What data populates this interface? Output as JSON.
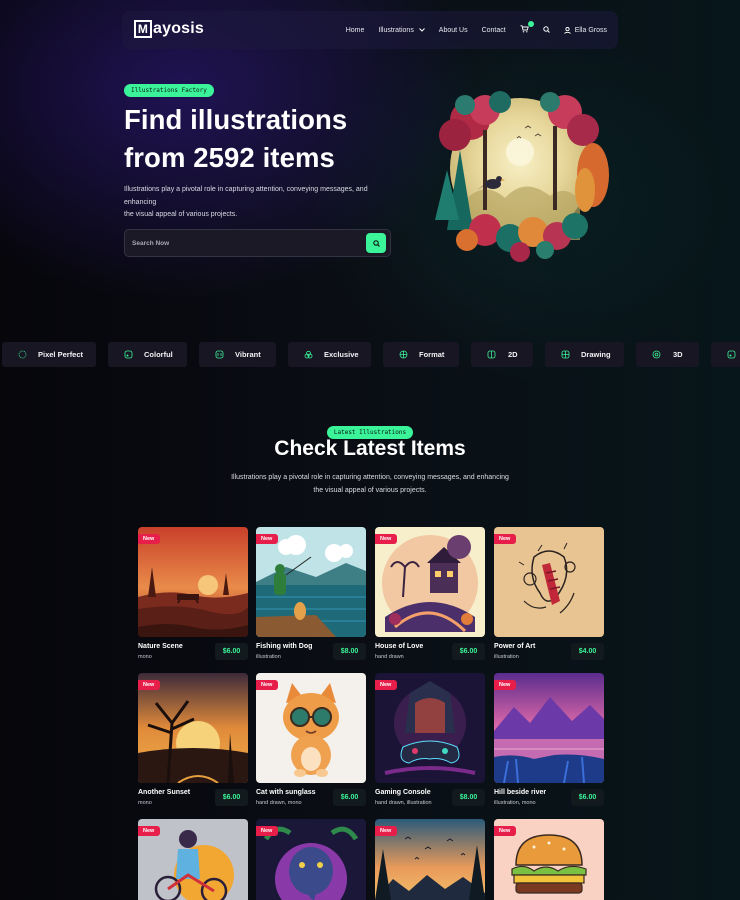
{
  "brand": {
    "logo_letter": "M",
    "logo_rest": "ayosis"
  },
  "nav": {
    "items": [
      {
        "label": "Home"
      },
      {
        "label": "Illustrations"
      },
      {
        "label": "About Us"
      },
      {
        "label": "Contact"
      }
    ],
    "user_name": "Ella Gross",
    "icons": [
      "cart-icon",
      "search-icon",
      "user-icon",
      "chevron-down-icon"
    ]
  },
  "hero": {
    "pill": "Illustrations Factory",
    "title_line1": "Find illustrations",
    "title_line2": "from 2592 items",
    "desc_line1": "Illustrations play a pivotal role in capturing attention, conveying messages, and enhancing",
    "desc_line2": "the visual appeal of various projects.",
    "search_placeholder": "Search Now"
  },
  "features": [
    {
      "label": "Pixel Perfect",
      "icon": "pixel-icon"
    },
    {
      "label": "Colorful",
      "icon": "palette-icon"
    },
    {
      "label": "Vibrant",
      "icon": "vibrant-icon"
    },
    {
      "label": "Exclusive",
      "icon": "gem-icon"
    },
    {
      "label": "Format",
      "icon": "format-icon"
    },
    {
      "label": "2D",
      "icon": "square-icon"
    },
    {
      "label": "Drawing",
      "icon": "drawing-icon"
    },
    {
      "label": "3D",
      "icon": "cube-icon"
    },
    {
      "label": "",
      "icon": "palette-icon"
    }
  ],
  "latest": {
    "pill": "Latest Illustrations",
    "title": "Check Latest Items",
    "desc_line1": "Illustrations play a pivotal role in capturing attention, conveying messages, and enhancing",
    "desc_line2": "the visual appeal of various projects."
  },
  "items": [
    {
      "badge": "New",
      "title": "Nature Scene",
      "category": "mono",
      "price": "$6.00"
    },
    {
      "badge": "New",
      "title": "Fishing with Dog",
      "category": "illustration",
      "price": "$8.00"
    },
    {
      "badge": "New",
      "title": "House of Love",
      "category": "hand drawn",
      "price": "$6.00"
    },
    {
      "badge": "New",
      "title": "Power of Art",
      "category": "illustration",
      "price": "$4.00"
    },
    {
      "badge": "New",
      "title": "Another Sunset",
      "category": "mono",
      "price": "$6.00"
    },
    {
      "badge": "New",
      "title": "Cat with sunglass",
      "category": "hand drawn, mono",
      "price": "$6.00"
    },
    {
      "badge": "New",
      "title": "Gaming Console",
      "category": "hand drawn, illustration",
      "price": "$8.00"
    },
    {
      "badge": "New",
      "title": "Hill beside river",
      "category": "illustration, mono",
      "price": "$6.00"
    },
    {
      "badge": "New"
    },
    {
      "badge": "New"
    },
    {
      "badge": "New"
    },
    {
      "badge": "New"
    }
  ],
  "colors": {
    "accent": "#3bf49a",
    "badge": "#e81e4a",
    "panel": "#171622"
  }
}
